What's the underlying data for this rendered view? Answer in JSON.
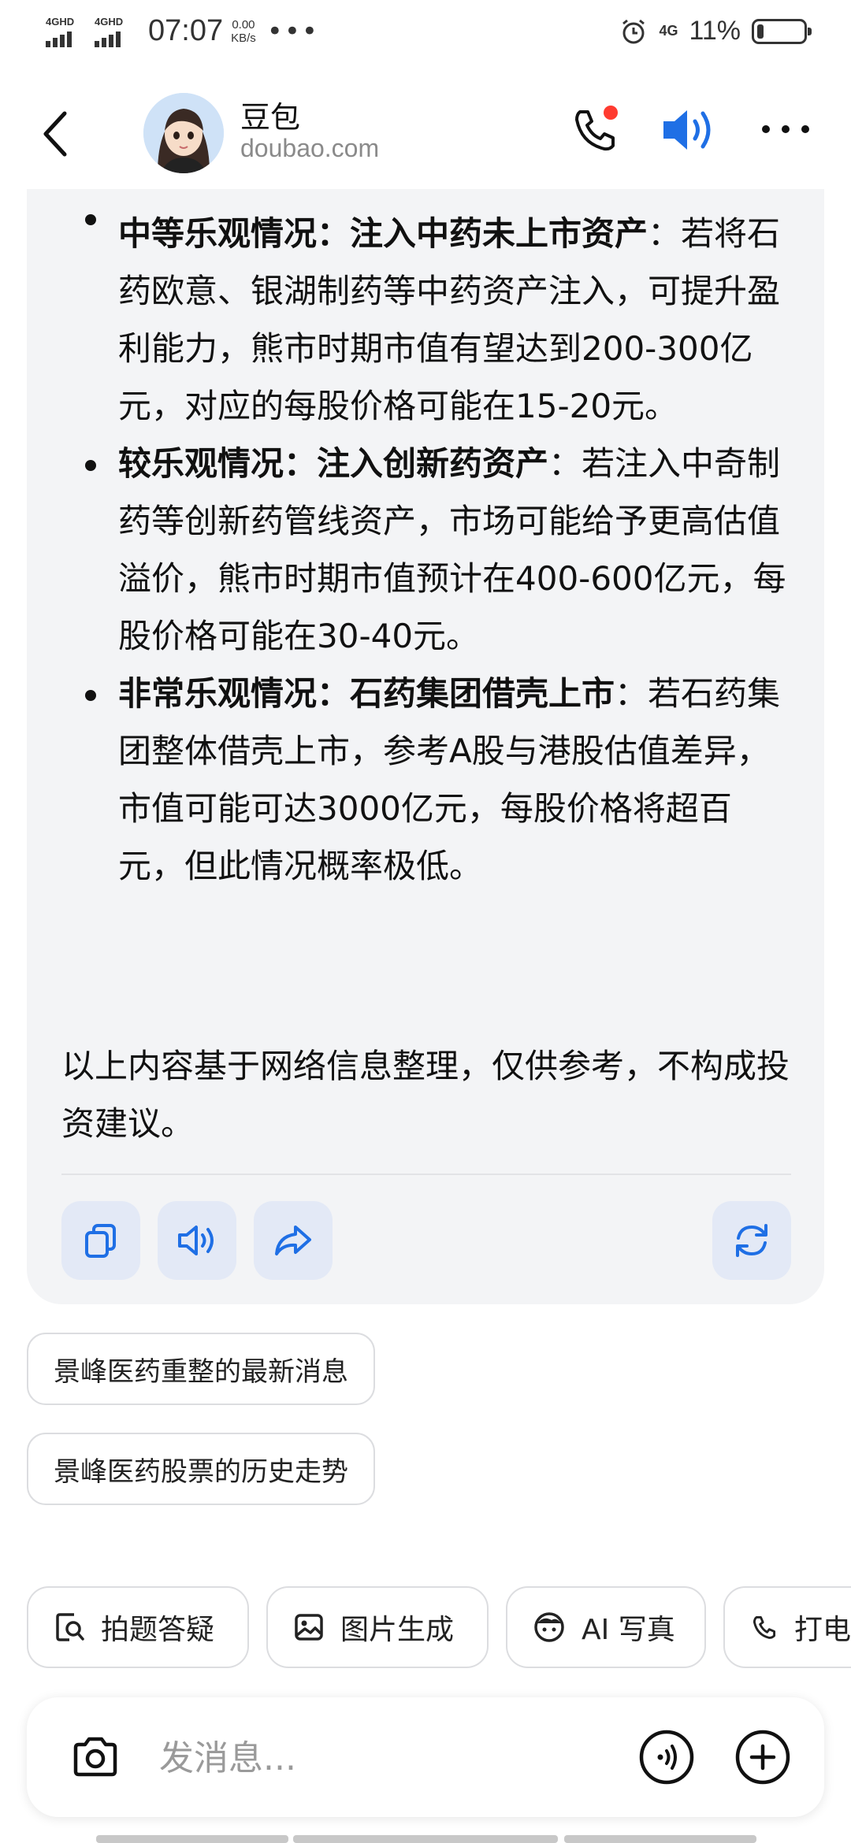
{
  "status_bar": {
    "net1": "4GHD",
    "net2": "4GHD",
    "time": "07:07",
    "speed_value": "0.00",
    "speed_unit": "KB/s",
    "more": "•••",
    "net_right": "4G",
    "battery_pct": "11%"
  },
  "header": {
    "bot_name": "豆包",
    "bot_domain": "doubao.com"
  },
  "message": {
    "bullets": [
      {
        "bold": "中等乐观情况：注入中药未上市资产",
        "text": "：若将石药欧意、银湖制药等中药资产注入，可提升盈利能力，熊市时期市值有望达到200-300亿元，对应的每股价格可能在15-20元。"
      },
      {
        "bold": "较乐观情况：注入创新药资产",
        "text": "：若注入中奇制药等创新药管线资产，市场可能给予更高估值溢价，熊市时期市值预计在400-600亿元，每股价格可能在30-40元。"
      },
      {
        "bold": "非常乐观情况：石药集团借壳上市",
        "text": "：若石药集团整体借壳上市，参考A股与港股估值差异，市值可能可达3000亿元，每股价格将超百元，但此情况概率极低。"
      }
    ],
    "disclaimer": "以上内容基于网络信息整理，仅供参考，不构成投资建议。"
  },
  "suggestions": [
    "景峰医药重整的最新消息",
    "景峰医药股票的历史走势"
  ],
  "tools": [
    {
      "label": "拍题答疑",
      "icon": "photo-question-icon"
    },
    {
      "label": "图片生成",
      "icon": "image-icon"
    },
    {
      "label": "AI 写真",
      "icon": "face-icon"
    },
    {
      "label": "打电话",
      "icon": "phone-icon"
    }
  ],
  "input": {
    "placeholder": "发消息..."
  },
  "colors": {
    "accent": "#1f6fe5",
    "call_dot": "#ff3b30",
    "card_bg": "#f3f4f6"
  }
}
